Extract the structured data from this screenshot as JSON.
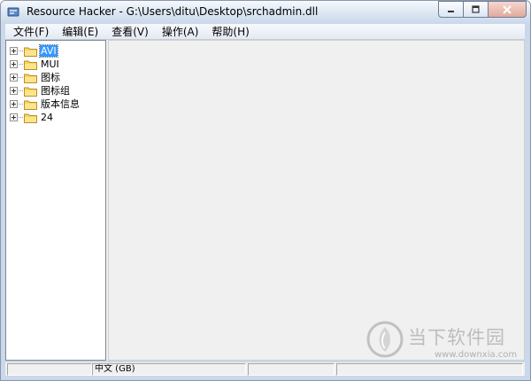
{
  "window": {
    "title": "Resource Hacker  -  G:\\Users\\ditu\\Desktop\\srchadmin.dll",
    "icon": "resource-hacker-icon"
  },
  "window_controls": [
    "minimize-icon",
    "maximize-icon",
    "close-icon"
  ],
  "menu": [
    {
      "label": "文件(F)"
    },
    {
      "label": "编辑(E)"
    },
    {
      "label": "查看(V)"
    },
    {
      "label": "操作(A)"
    },
    {
      "label": "帮助(H)"
    }
  ],
  "tree": {
    "items": [
      {
        "label": "AVI",
        "selected": true
      },
      {
        "label": "MUI",
        "selected": false
      },
      {
        "label": "图标",
        "selected": false
      },
      {
        "label": "图标组",
        "selected": false
      },
      {
        "label": "版本信息",
        "selected": false
      },
      {
        "label": "24",
        "selected": false
      }
    ]
  },
  "statusbar": {
    "panes": [
      "",
      "中文 (GB)",
      "",
      ""
    ]
  },
  "watermark": {
    "brand": "当下软件园",
    "url": "www.downxia.com"
  },
  "colors": {
    "folder": "#f7d55a",
    "selection": "#3399ff",
    "titlebar": "#dce6f3"
  }
}
